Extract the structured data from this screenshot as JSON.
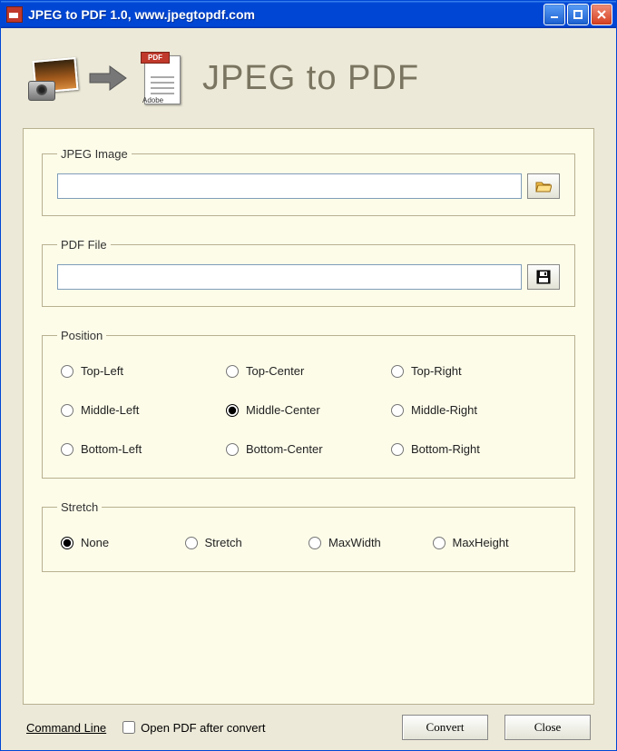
{
  "window": {
    "title": "JPEG to PDF 1.0, www.jpegtopdf.com"
  },
  "header": {
    "pdf_badge": "PDF",
    "pdf_brand": "Adobe",
    "title": "JPEG to PDF"
  },
  "groups": {
    "jpeg": {
      "legend": "JPEG Image",
      "value": ""
    },
    "pdf": {
      "legend": "PDF File",
      "value": ""
    },
    "position": {
      "legend": "Position",
      "options": {
        "tl": "Top-Left",
        "tc": "Top-Center",
        "tr": "Top-Right",
        "ml": "Middle-Left",
        "mc": "Middle-Center",
        "mr": "Middle-Right",
        "bl": "Bottom-Left",
        "bc": "Bottom-Center",
        "br": "Bottom-Right"
      },
      "selected": "mc"
    },
    "stretch": {
      "legend": "Stretch",
      "options": {
        "none": "None",
        "stretch": "Stretch",
        "maxw": "MaxWidth",
        "maxh": "MaxHeight"
      },
      "selected": "none"
    }
  },
  "footer": {
    "command_line": "Command Line",
    "open_after": "Open PDF after convert",
    "open_after_checked": false,
    "convert": "Convert",
    "close": "Close"
  }
}
